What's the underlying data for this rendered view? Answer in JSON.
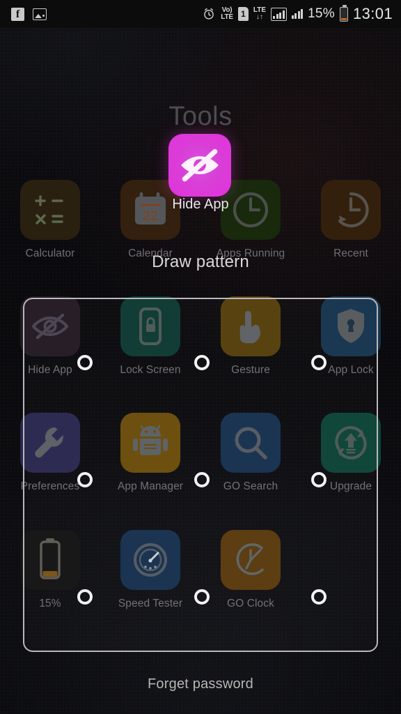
{
  "statusbar": {
    "notifications": [
      {
        "name": "facebook-icon",
        "glyph": "f"
      },
      {
        "name": "image-icon",
        "glyph": ""
      }
    ],
    "alarm_icon": "alarm-icon",
    "volte_line1": "Vo)",
    "volte_line2": "LTE",
    "sim_label": "1",
    "lte_label": "LTE",
    "lte_arrows": "↓↑",
    "battery_percent": "15%",
    "battery_level": 15,
    "clock": "13:01"
  },
  "home": {
    "page_title": "Tools",
    "top_row": [
      {
        "label": "Calculator",
        "icon": "calculator-icon",
        "color": "#2a2010"
      },
      {
        "label": "Calendar",
        "icon": "calendar-icon",
        "color": "#33200f"
      },
      {
        "label": "Apps Running",
        "icon": "clock-icon",
        "color": "#18290c"
      },
      {
        "label": "Recent",
        "icon": "clock-arrow-icon",
        "color": "#33200c"
      }
    ],
    "grid_rows": [
      [
        {
          "label": "Hide App",
          "icon": "eye-off-icon",
          "color": "#241a24"
        },
        {
          "label": "Lock Screen",
          "icon": "padlock-phone-icon",
          "color": "#0e3a33"
        },
        {
          "label": "Gesture",
          "icon": "hand-point-icon",
          "color": "#55400c"
        },
        {
          "label": "App Lock",
          "icon": "shield-keyhole-icon",
          "color": "#17354f"
        }
      ],
      [
        {
          "label": "Preferences",
          "icon": "wrench-icon",
          "color": "#2a2750"
        },
        {
          "label": "App Manager",
          "icon": "android-icon",
          "color": "#6b4d0c"
        },
        {
          "label": "GO Search",
          "icon": "magnifier-icon",
          "color": "#17304f"
        },
        {
          "label": "Upgrade",
          "icon": "upgrade-arrow-icon",
          "color": "#0d4438"
        }
      ],
      [
        {
          "label": "15%",
          "icon": "battery-widget-icon",
          "color": "#141414"
        },
        {
          "label": "Speed Tester",
          "icon": "gauge-icon",
          "color": "#17304f"
        },
        {
          "label": "GO Clock",
          "icon": "clock-face-icon",
          "color": "#5a3a0e"
        },
        {
          "label": "",
          "icon": "empty-slot",
          "color": "transparent"
        }
      ]
    ]
  },
  "drag": {
    "label": "Hide App",
    "icon": "eye-off-icon",
    "color": "#dc3fd8"
  },
  "lock": {
    "prompt": "Draw pattern",
    "forget_label": "Forget password",
    "dot_columns": [
      120,
      288,
      456
    ],
    "dot_rows": [
      518,
      686,
      854
    ],
    "dot_count": 9
  }
}
